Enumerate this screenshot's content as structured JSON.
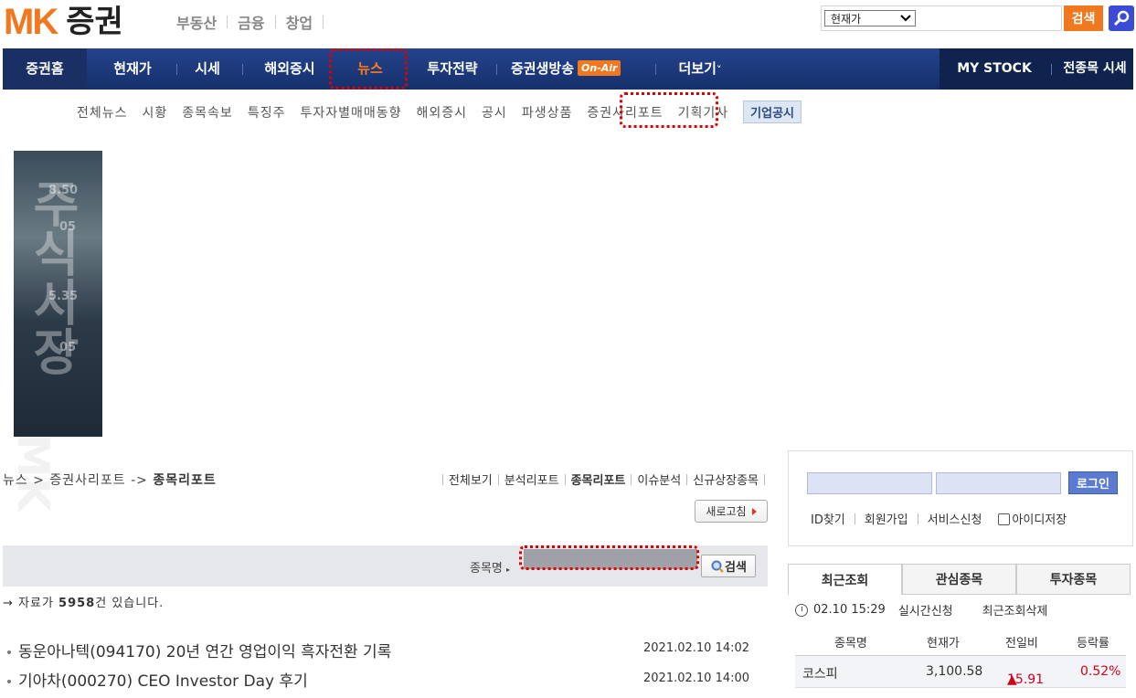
{
  "header": {
    "logo_mk": "MK",
    "logo_text": "증권",
    "top_links": [
      "부동산",
      "금융",
      "창업"
    ],
    "search": {
      "select_value": "현재가",
      "button_label": "검색"
    }
  },
  "gnb": {
    "home": "증권홈",
    "items": [
      "현재가",
      "시세",
      "해외증시",
      "뉴스",
      "투자전략",
      "증권생방송",
      "더보기"
    ],
    "onair": "On-Air",
    "more_suffix": "˅",
    "right": [
      "MY STOCK",
      "전종목 시세"
    ]
  },
  "subnav": {
    "items": [
      "전체뉴스",
      "시황",
      "종목속보",
      "특징주",
      "투자자별매매동향",
      "해외증시",
      "공시",
      "파생상품",
      "증권사리포트",
      "기획기사"
    ],
    "badge": "기업공시"
  },
  "banner": {
    "numbers": [
      "8.50",
      "05",
      "5.35",
      "05"
    ],
    "vertical_text": "주식시장"
  },
  "content": {
    "breadcrumb_prefix": "뉴스 > 증권사리포트 -> ",
    "breadcrumb_current": "종목리포트",
    "category_links": [
      "전체보기",
      "분석리포트",
      "종목리포트",
      "이슈분석",
      "신규상장종목"
    ],
    "active_category": "종목리포트",
    "refresh_label": "새로고침",
    "search_label": "종목명",
    "search_button": "검색",
    "count_prefix": "→ 자료가 ",
    "count": "5958",
    "count_suffix": "건 있습니다.",
    "news": [
      {
        "title": "동운아나텍(094170) 20년 연간 영업이익 흑자전환 기록",
        "date": "2021.02.10 14:02"
      },
      {
        "title": "기아차(000270) CEO Investor Day 후기",
        "date": "2021.02.10 14:00"
      }
    ]
  },
  "side": {
    "login_button": "로그인",
    "login_links": [
      "ID찾기",
      "회원가입",
      "서비스신청"
    ],
    "remember_label": "아이디저장",
    "tabs": [
      "최근조회",
      "관심종목",
      "투자종목"
    ],
    "recent_time": "02.10 15:29",
    "realtime_label": "실시간신청",
    "delete_label": "최근조회삭제",
    "table_headers": [
      "종목명",
      "현재가",
      "전일비",
      "등락률"
    ],
    "rows": [
      {
        "name": "코스피",
        "price": "3,100.58",
        "change": "15.91",
        "rate": "0.52%"
      }
    ],
    "up_color": "#d0021b"
  }
}
